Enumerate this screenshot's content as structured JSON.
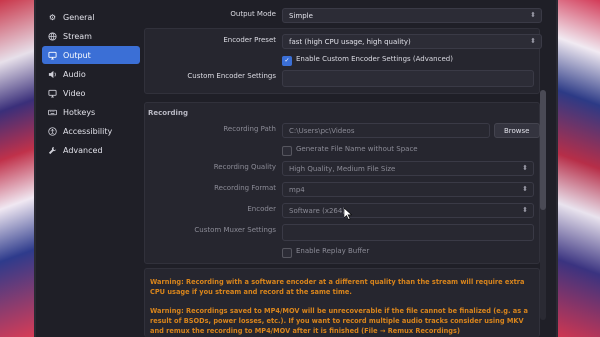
{
  "sidebar": {
    "items": [
      {
        "label": "General",
        "icon": "gear-icon"
      },
      {
        "label": "Stream",
        "icon": "globe-icon"
      },
      {
        "label": "Output",
        "icon": "monitor-icon"
      },
      {
        "label": "Audio",
        "icon": "speaker-icon"
      },
      {
        "label": "Video",
        "icon": "video-icon"
      },
      {
        "label": "Hotkeys",
        "icon": "keyboard-icon"
      },
      {
        "label": "Accessibility",
        "icon": "accessibility-icon"
      },
      {
        "label": "Advanced",
        "icon": "wrench-icon"
      }
    ],
    "active_index": 2
  },
  "output": {
    "mode_label": "Output Mode",
    "mode_value": "Simple",
    "encoder_preset_label": "Encoder Preset",
    "encoder_preset_value": "fast (high CPU usage, high quality)",
    "custom_encoder_check_label": "Enable Custom Encoder Settings (Advanced)",
    "custom_encoder_checked": true,
    "custom_encoder_settings_label": "Custom Encoder Settings",
    "custom_encoder_settings_value": ""
  },
  "recording": {
    "section_title": "Recording",
    "path_label": "Recording Path",
    "path_value": "C:\\Users\\pc\\Videos",
    "browse_label": "Browse",
    "no_space_label": "Generate File Name without Space",
    "no_space_checked": false,
    "quality_label": "Recording Quality",
    "quality_value": "High Quality, Medium File Size",
    "format_label": "Recording Format",
    "format_value": "mp4",
    "encoder_label": "Encoder",
    "encoder_value": "Software (x264)",
    "muxer_label": "Custom Muxer Settings",
    "muxer_value": "",
    "replay_label": "Enable Replay Buffer",
    "replay_checked": false
  },
  "warnings": [
    "Warning: Recording with a software encoder at a different quality than the stream will require extra CPU usage if you stream and record at the same time.",
    "Warning: Recordings saved to MP4/MOV will be unrecoverable if the file cannot be finalized (e.g. as a result of BSODs, power losses, etc.). If you want to record multiple audio tracks consider using MKV and remux the recording to MP4/MOV after it is finished (File → Remux Recordings)"
  ],
  "colors": {
    "accent": "#3b6fd6",
    "warning": "#d9851c"
  }
}
